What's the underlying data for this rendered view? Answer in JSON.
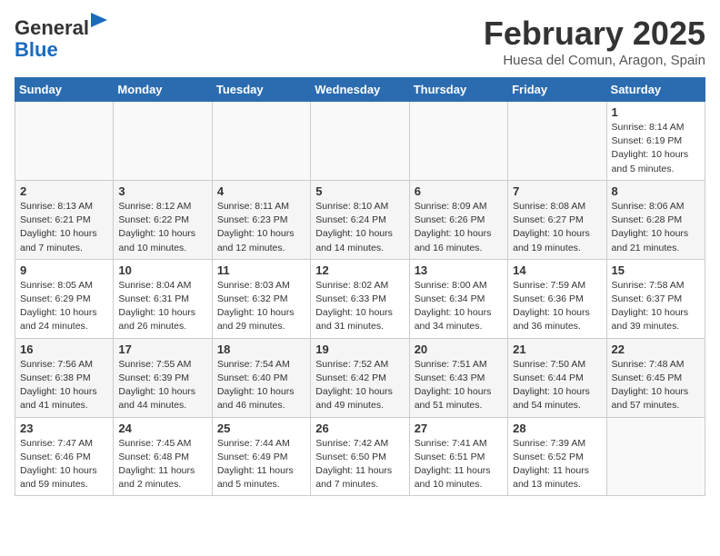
{
  "logo": {
    "line1": "General",
    "line2": "Blue"
  },
  "title": "February 2025",
  "location": "Huesa del Comun, Aragon, Spain",
  "weekdays": [
    "Sunday",
    "Monday",
    "Tuesday",
    "Wednesday",
    "Thursday",
    "Friday",
    "Saturday"
  ],
  "weeks": [
    [
      {
        "day": "",
        "info": ""
      },
      {
        "day": "",
        "info": ""
      },
      {
        "day": "",
        "info": ""
      },
      {
        "day": "",
        "info": ""
      },
      {
        "day": "",
        "info": ""
      },
      {
        "day": "",
        "info": ""
      },
      {
        "day": "1",
        "info": "Sunrise: 8:14 AM\nSunset: 6:19 PM\nDaylight: 10 hours\nand 5 minutes."
      }
    ],
    [
      {
        "day": "2",
        "info": "Sunrise: 8:13 AM\nSunset: 6:21 PM\nDaylight: 10 hours\nand 7 minutes."
      },
      {
        "day": "3",
        "info": "Sunrise: 8:12 AM\nSunset: 6:22 PM\nDaylight: 10 hours\nand 10 minutes."
      },
      {
        "day": "4",
        "info": "Sunrise: 8:11 AM\nSunset: 6:23 PM\nDaylight: 10 hours\nand 12 minutes."
      },
      {
        "day": "5",
        "info": "Sunrise: 8:10 AM\nSunset: 6:24 PM\nDaylight: 10 hours\nand 14 minutes."
      },
      {
        "day": "6",
        "info": "Sunrise: 8:09 AM\nSunset: 6:26 PM\nDaylight: 10 hours\nand 16 minutes."
      },
      {
        "day": "7",
        "info": "Sunrise: 8:08 AM\nSunset: 6:27 PM\nDaylight: 10 hours\nand 19 minutes."
      },
      {
        "day": "8",
        "info": "Sunrise: 8:06 AM\nSunset: 6:28 PM\nDaylight: 10 hours\nand 21 minutes."
      }
    ],
    [
      {
        "day": "9",
        "info": "Sunrise: 8:05 AM\nSunset: 6:29 PM\nDaylight: 10 hours\nand 24 minutes."
      },
      {
        "day": "10",
        "info": "Sunrise: 8:04 AM\nSunset: 6:31 PM\nDaylight: 10 hours\nand 26 minutes."
      },
      {
        "day": "11",
        "info": "Sunrise: 8:03 AM\nSunset: 6:32 PM\nDaylight: 10 hours\nand 29 minutes."
      },
      {
        "day": "12",
        "info": "Sunrise: 8:02 AM\nSunset: 6:33 PM\nDaylight: 10 hours\nand 31 minutes."
      },
      {
        "day": "13",
        "info": "Sunrise: 8:00 AM\nSunset: 6:34 PM\nDaylight: 10 hours\nand 34 minutes."
      },
      {
        "day": "14",
        "info": "Sunrise: 7:59 AM\nSunset: 6:36 PM\nDaylight: 10 hours\nand 36 minutes."
      },
      {
        "day": "15",
        "info": "Sunrise: 7:58 AM\nSunset: 6:37 PM\nDaylight: 10 hours\nand 39 minutes."
      }
    ],
    [
      {
        "day": "16",
        "info": "Sunrise: 7:56 AM\nSunset: 6:38 PM\nDaylight: 10 hours\nand 41 minutes."
      },
      {
        "day": "17",
        "info": "Sunrise: 7:55 AM\nSunset: 6:39 PM\nDaylight: 10 hours\nand 44 minutes."
      },
      {
        "day": "18",
        "info": "Sunrise: 7:54 AM\nSunset: 6:40 PM\nDaylight: 10 hours\nand 46 minutes."
      },
      {
        "day": "19",
        "info": "Sunrise: 7:52 AM\nSunset: 6:42 PM\nDaylight: 10 hours\nand 49 minutes."
      },
      {
        "day": "20",
        "info": "Sunrise: 7:51 AM\nSunset: 6:43 PM\nDaylight: 10 hours\nand 51 minutes."
      },
      {
        "day": "21",
        "info": "Sunrise: 7:50 AM\nSunset: 6:44 PM\nDaylight: 10 hours\nand 54 minutes."
      },
      {
        "day": "22",
        "info": "Sunrise: 7:48 AM\nSunset: 6:45 PM\nDaylight: 10 hours\nand 57 minutes."
      }
    ],
    [
      {
        "day": "23",
        "info": "Sunrise: 7:47 AM\nSunset: 6:46 PM\nDaylight: 10 hours\nand 59 minutes."
      },
      {
        "day": "24",
        "info": "Sunrise: 7:45 AM\nSunset: 6:48 PM\nDaylight: 11 hours\nand 2 minutes."
      },
      {
        "day": "25",
        "info": "Sunrise: 7:44 AM\nSunset: 6:49 PM\nDaylight: 11 hours\nand 5 minutes."
      },
      {
        "day": "26",
        "info": "Sunrise: 7:42 AM\nSunset: 6:50 PM\nDaylight: 11 hours\nand 7 minutes."
      },
      {
        "day": "27",
        "info": "Sunrise: 7:41 AM\nSunset: 6:51 PM\nDaylight: 11 hours\nand 10 minutes."
      },
      {
        "day": "28",
        "info": "Sunrise: 7:39 AM\nSunset: 6:52 PM\nDaylight: 11 hours\nand 13 minutes."
      },
      {
        "day": "",
        "info": ""
      }
    ]
  ]
}
